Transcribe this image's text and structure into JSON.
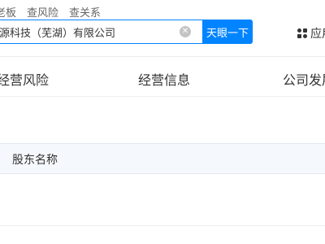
{
  "search": {
    "tabs": [
      "老板",
      "查风险",
      "查关系"
    ],
    "value": "源科技（芜湖）有限公司",
    "button_label": "天眼一下"
  },
  "header": {
    "apps_label": "应用"
  },
  "main_tabs": [
    "经营风险",
    "经营信息",
    "公司发展"
  ],
  "table": {
    "columns": [
      "股东名称"
    ]
  },
  "colors": {
    "accent": "#0084ff",
    "table_header_bg": "#f5f8fc"
  }
}
